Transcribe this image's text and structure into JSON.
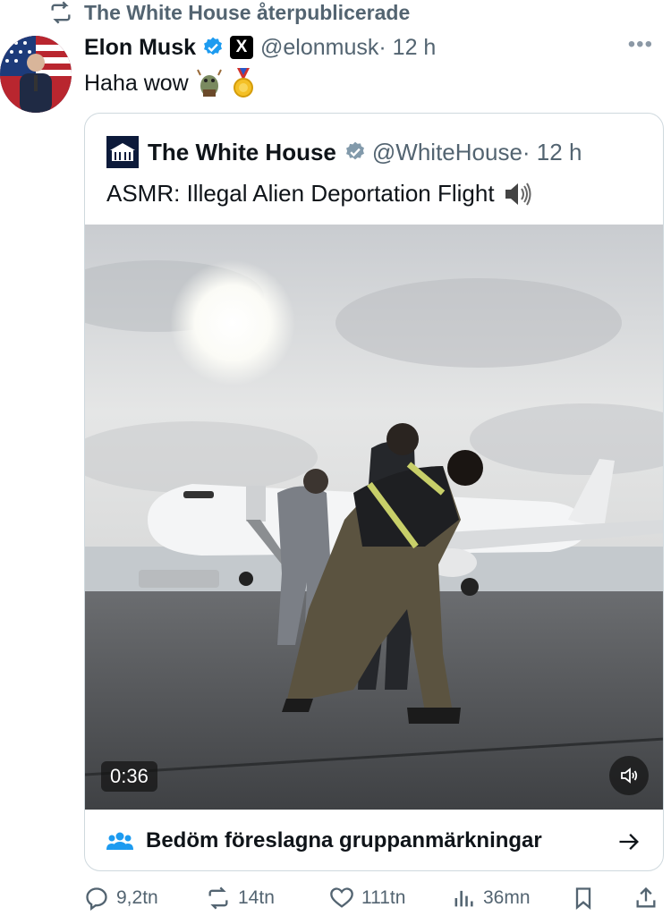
{
  "repost": {
    "text": "The White House återpublicerade",
    "icon": "repost-icon"
  },
  "tweet": {
    "author_name": "Elon Musk",
    "handle": "@elonmusk",
    "time": "· 12 h",
    "text": "Haha wow",
    "emojis": [
      "troll-emoji",
      "medal-emoji"
    ],
    "more_icon": "more-icon"
  },
  "quote": {
    "author_name": "The White House",
    "handle": "@WhiteHouse",
    "time": "· 12 h",
    "text": "ASMR: Illegal Alien Deportation Flight",
    "text_emoji": "speaker-emoji",
    "video": {
      "timecode": "0:36",
      "mute_icon": "volume-icon"
    },
    "community_notes": {
      "label": "Bedöm föreslagna gruppanmärkningar",
      "icon": "people-icon",
      "arrow_icon": "arrow-right-icon"
    }
  },
  "actions": {
    "replies": "9,2tn",
    "reposts": "14tn",
    "likes": "111tn",
    "views": "36mn"
  },
  "colors": {
    "verified": "#1d9bf0",
    "muted": "#536471",
    "border": "#cfd9de"
  }
}
